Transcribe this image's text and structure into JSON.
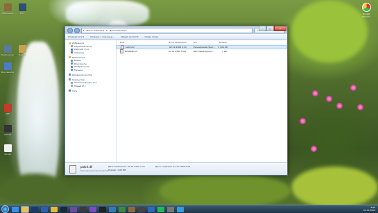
{
  "desktop": {
    "icons_left": [
      {
        "label": "Избранное",
        "color": "#8c6a3a"
      },
      {
        "label": "DAT",
        "color": "#2f4e7a"
      },
      {
        "label": "Компьютер",
        "color": "#5c7a9c"
      },
      {
        "label": "Файлы",
        "color": "#c8a050"
      },
      {
        "label": "Документы",
        "color": "#4a7cc7"
      },
      {
        "label": "PDF",
        "color": "#c73a2a"
      },
      {
        "label": "Games",
        "color": "#333333"
      },
      {
        "label": "Архив",
        "color": "#f0f0f0"
      }
    ],
    "recycle_bin_label": "Google Chrome"
  },
  "window": {
    "address": {
      "parts": [
        "Prince of Persia 1",
        "Дополнительно"
      ]
    },
    "search_placeholder": "Поиск: Дополнительно",
    "buttons": {
      "minimize": "–",
      "maximize": "□",
      "close": "✕"
    },
    "toolbar": {
      "organize": "Упорядочить ▾",
      "open": "Открыть с помощью...",
      "share": "Общий доступ ▾",
      "new_folder": "Новая папка"
    },
    "nav": [
      {
        "label": "Избранное",
        "sub": false,
        "color": "#e8c24a"
      },
      {
        "label": "Недавние места",
        "sub": true,
        "color": "#8aa6c7"
      },
      {
        "label": "Рабочий стол",
        "sub": true,
        "color": "#4a7ab8"
      },
      {
        "label": "Загрузки",
        "sub": true,
        "color": "#4a7ab8"
      },
      {
        "gap": true
      },
      {
        "label": "Библиотеки",
        "sub": false,
        "color": "#d8b454"
      },
      {
        "label": "Видео",
        "sub": true,
        "color": "#6a8fc0"
      },
      {
        "label": "Документы",
        "sub": true,
        "color": "#6a8fc0"
      },
      {
        "label": "Изображения",
        "sub": true,
        "color": "#6a8fc0"
      },
      {
        "label": "Музыка",
        "sub": true,
        "color": "#6a8fc0"
      },
      {
        "gap": true
      },
      {
        "label": "Домашняя группа",
        "sub": false,
        "color": "#4e8fd8"
      },
      {
        "gap": true
      },
      {
        "label": "Компьютер",
        "sub": false,
        "color": "#7a8fa8"
      },
      {
        "label": "Локальный диск (C:)",
        "sub": true,
        "color": "#9aa8b8"
      },
      {
        "label": "Новый (E:)",
        "sub": true,
        "color": "#9aa8b8"
      },
      {
        "gap": true
      },
      {
        "label": "Сеть",
        "sub": false,
        "color": "#4e7fb8"
      }
    ],
    "columns": {
      "name": "Имя",
      "date": "Дата изменения",
      "type": "Тип",
      "size": "Размер"
    },
    "files": [
      {
        "name": "patch.dll",
        "date": "02.12.2009 1:32",
        "type": "Расширение прил...",
        "size": "1 100 КБ",
        "selected": true
      },
      {
        "name": "README.txt",
        "date": "02.12.2009 0:09",
        "type": "Текстовый докум...",
        "size": "1 КБ",
        "selected": false
      }
    ],
    "details": {
      "name": "patch.dll",
      "type": "Расширение приложения",
      "modified": "Дата изменения: 02.12.2009 1:32",
      "size": "Размер: 1,06 МБ",
      "created": "Дата создания: 02.12.2009 0:09"
    }
  },
  "taskbar": {
    "items": [
      {
        "name": "ie",
        "color": "#3b8fe0"
      },
      {
        "name": "explorer",
        "color": "#e6c25a",
        "active": true
      },
      {
        "name": "photoshop",
        "color": "#1b3a6b"
      },
      {
        "name": "word",
        "color": "#2b5fb3"
      },
      {
        "name": "chrome",
        "color": "#e6b83a"
      },
      {
        "name": "steam",
        "color": "#1b2838"
      },
      {
        "name": "media",
        "color": "#6b4b9b"
      },
      {
        "name": "gamepad",
        "color": "#3a3a3a"
      },
      {
        "name": "vs",
        "color": "#7b4bc2"
      },
      {
        "name": "terminal",
        "color": "#222222"
      },
      {
        "name": "monitor",
        "color": "#2e7ab8"
      },
      {
        "name": "game",
        "color": "#3a8a3a"
      },
      {
        "name": "tool",
        "color": "#8a6a3a"
      },
      {
        "name": "unity",
        "color": "#444444"
      },
      {
        "name": "brackets",
        "color": "#2a6ab8"
      },
      {
        "name": "spotify",
        "color": "#1db954"
      },
      {
        "name": "settings",
        "color": "#777777"
      },
      {
        "name": "telegram",
        "color": "#2aa0e0"
      }
    ],
    "clock_time": "3:09",
    "clock_date": "02.12.2009"
  }
}
